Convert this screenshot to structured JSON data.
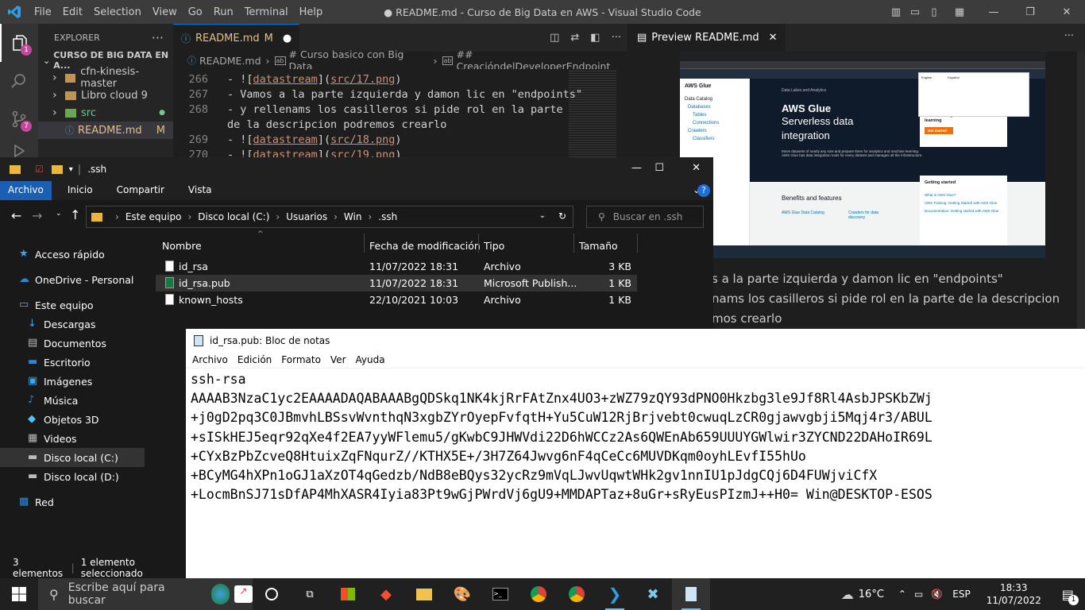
{
  "vscode": {
    "menu": [
      "File",
      "Edit",
      "Selection",
      "View",
      "Go",
      "Run",
      "Terminal",
      "Help"
    ],
    "title": "● README.md - Curso de Big Data en AWS - Visual Studio Code",
    "activity_badges": [
      "1",
      "7"
    ],
    "explorer_title": "EXPLORER",
    "workspace": "CURSO DE BIG DATA EN A...",
    "tree": [
      {
        "label": "cfn-kinesis-master",
        "kind": "folder",
        "status": ""
      },
      {
        "label": "Libro cloud 9",
        "kind": "folder",
        "status": ""
      },
      {
        "label": "src",
        "kind": "folder",
        "status": "●"
      },
      {
        "label": "README.md",
        "kind": "file",
        "status": "M"
      }
    ],
    "editor_tab": {
      "label": "README.md",
      "status": "M"
    },
    "breadcrumb": [
      "README.md",
      "# Curso basico con Big Data",
      "## CreacióndelDeveloperEndpoint"
    ],
    "code_lines": [
      {
        "n": "266",
        "text": "- ![datastream](src/17.png)"
      },
      {
        "n": "267",
        "text": "- Vamos a la parte izquierda y damon lic en \"endpoints\""
      },
      {
        "n": "268",
        "text": "- y rellenams los casilleros si pide rol en la parte"
      },
      {
        "n": "",
        "text": "de la descripcion podremos crearlo"
      },
      {
        "n": "269",
        "text": "- ![datastream](src/18.png)"
      },
      {
        "n": "270",
        "text": "- ![datastream](src/19.png)"
      }
    ],
    "preview_tab": "Preview README.md",
    "preview_text": [
      "s a la parte izquierda y damon lic en \"endpoints\"",
      "nams los casilleros si pide rol en la parte de la descripcion",
      "mos crearlo"
    ],
    "aws_shot": {
      "sidebar_title": "AWS Glue",
      "crumb": "Data Lakes and Analytics",
      "hero_title": "AWS Glue",
      "hero_sub": "Serverless data integration",
      "hero_desc": "Move datasets of nearly any size and prepare them for analytics and machine learning. AWS Glue has data integration tools for every dataset and manages all the infrastructure.",
      "card_title": "Use AWS Glue to move and prepare data for analytics and machine learning",
      "card_btn": "Get started",
      "benefits": "Benefits and features",
      "getting_started": "Getting started",
      "menu": [
        "Data Catalog",
        "Databases",
        "Tables",
        "Connections",
        "Crawlers",
        "Classifiers"
      ],
      "features": [
        "AWS Glue Data Catalog",
        "Crawlers for data discovery"
      ],
      "gs_links": [
        "What is AWS Glue?",
        "AWS Training: Getting Started with AWS Glue",
        "Documentation: Getting started with AWS Glue"
      ],
      "lang": [
        "English",
        "Español"
      ]
    }
  },
  "file_explorer": {
    "window_path": ".ssh",
    "ribbon": [
      "Archivo",
      "Inicio",
      "Compartir",
      "Vista"
    ],
    "address": [
      "Este equipo",
      "Disco local (C:)",
      "Usuarios",
      "Win",
      ".ssh"
    ],
    "search_placeholder": "Buscar en .ssh",
    "nav": [
      {
        "label": "Acceso rápido",
        "icon": "star-icon",
        "color": "#4aa3df"
      },
      {
        "label": "OneDrive - Personal",
        "icon": "cloud-icon",
        "color": "#2b88d8"
      },
      {
        "label": "Este equipo",
        "icon": "computer-icon",
        "color": "#5aa9e6"
      },
      {
        "label": "Descargas",
        "icon": "download-icon",
        "color": "#4aa3df"
      },
      {
        "label": "Documentos",
        "icon": "document-icon",
        "color": "#bbb"
      },
      {
        "label": "Escritorio",
        "icon": "desktop-icon",
        "color": "#2b88d8"
      },
      {
        "label": "Imágenes",
        "icon": "images-icon",
        "color": "#4aa3df"
      },
      {
        "label": "Música",
        "icon": "music-icon",
        "color": "#2b88d8"
      },
      {
        "label": "Objetos 3D",
        "icon": "cube-icon",
        "color": "#4fc3f7"
      },
      {
        "label": "Videos",
        "icon": "video-icon",
        "color": "#bbb"
      },
      {
        "label": "Disco local (C:)",
        "icon": "drive-icon",
        "color": "#bbb"
      },
      {
        "label": "Disco local (D:)",
        "icon": "drive-icon",
        "color": "#bbb"
      },
      {
        "label": "Red",
        "icon": "network-icon",
        "color": "#2b88d8"
      }
    ],
    "columns": [
      "Nombre",
      "Fecha de modificación",
      "Tipo",
      "Tamaño"
    ],
    "files": [
      {
        "name": "id_rsa",
        "date": "11/07/2022 18:31",
        "type": "Archivo",
        "size": "3 KB"
      },
      {
        "name": "id_rsa.pub",
        "date": "11/07/2022 18:31",
        "type": "Microsoft Publish...",
        "size": "1 KB"
      },
      {
        "name": "known_hosts",
        "date": "22/10/2021 10:03",
        "type": "Archivo",
        "size": "1 KB"
      }
    ],
    "status_count": "3 elementos",
    "status_selected": "1 elemento seleccionado"
  },
  "notepad": {
    "title": "id_rsa.pub: Bloc de notas",
    "menu": [
      "Archivo",
      "Edición",
      "Formato",
      "Ver",
      "Ayuda"
    ],
    "lines": [
      "ssh-rsa",
      "AAAAB3NzaC1yc2EAAAADAQABAAABgQDSkq1NK4kjRrFAtZnx4UO3+zWZ79zQY93dPNO0Hkzbg3le9Jf8Rl4AsbJPSKbZWj",
      "+j0gD2pq3C0JBmvhLBSsvWvnthqN3xgbZYrOyepFvfqtH+Yu5CuW12RjBrjvebt0cwuqLzCR0gjawvgbji5Mqj4r3/ABUL",
      "+sISkHEJ5eqr92qXe4f2EA7yyWFlemu5/gKwbC9JHWVdi22D6hWCCz2As6QWEnAb659UUUYGWlwir3ZYCND22DAHoIR69L",
      "+CYxBzPbZcveQ8HtuixZqFNqurZ//KTHX5E+/3H7Z64Jwvg6nF4qCeCc6MUVDKqm0oyhLEvfI55hUo",
      "+BCyMG4hXPn1oGJ1aXzOT4qGedzb/NdB8eBQys32ycRz9mVqLJwvUqwtWHk2gv1nnIU1pJdgCQj6D4FUWjviCfX",
      "+LocmBnSJ71sDfAP4MhXASR4Iyia83Pt9wGjPWrdVj6gU9+MMDAPTaz+8uGr+sRyEusPIzmJ++H0= Win@DESKTOP-ESOS"
    ]
  },
  "taskbar": {
    "search_placeholder": "Escribe aquí para buscar",
    "weather": "16°C",
    "lang": "ESP",
    "time": "18:33",
    "date": "11/07/2022",
    "notif_count": "1"
  }
}
